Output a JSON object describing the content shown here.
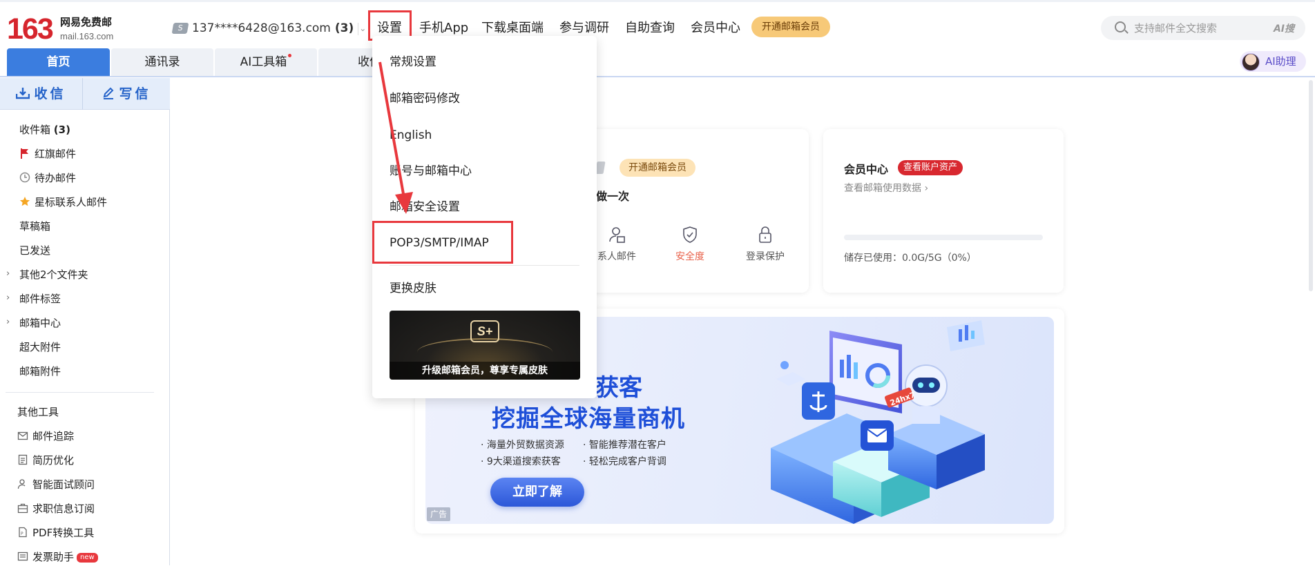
{
  "logo": {
    "number": "163",
    "name": "网易免费邮",
    "url": "mail.163.com"
  },
  "account": {
    "badge": "S",
    "address": "137****6428@163.com",
    "count": "(3)"
  },
  "topnav": {
    "settings": "设置",
    "mobile_app": "手机App",
    "desktop": "下载桌面端",
    "survey": "参与调研",
    "self_query": "自助查询",
    "member_center": "会员中心",
    "vip_button": "开通邮箱会员"
  },
  "search": {
    "placeholder": "支持邮件全文搜索",
    "ai_label": "AI搜"
  },
  "tabs": [
    {
      "label": "首页",
      "active": true
    },
    {
      "label": "通讯录"
    },
    {
      "label": "AI工具箱",
      "dot": true
    },
    {
      "label": "收件"
    }
  ],
  "ai_assistant": "AI助理",
  "sidebar": {
    "receive": "收信",
    "write": "写信",
    "items": [
      {
        "label": "收件箱",
        "count": "(3)"
      },
      {
        "label": "红旗邮件",
        "icon": "flag-icon"
      },
      {
        "label": "待办邮件",
        "icon": "clock-icon"
      },
      {
        "label": "星标联系人邮件",
        "icon": "star-icon"
      },
      {
        "label": "草稿箱"
      },
      {
        "label": "已发送"
      },
      {
        "label": "其他2个文件夹"
      },
      {
        "label": "邮件标签"
      },
      {
        "label": "邮箱中心"
      },
      {
        "label": "超大附件"
      },
      {
        "label": "邮箱附件"
      }
    ],
    "tools_title": "其他工具",
    "tools": [
      {
        "label": "邮件追踪",
        "icon": "mail-track-icon"
      },
      {
        "label": "简历优化",
        "icon": "resume-icon"
      },
      {
        "label": "智能面试顾问",
        "icon": "interview-icon"
      },
      {
        "label": "求职信息订阅",
        "icon": "job-icon"
      },
      {
        "label": "PDF转换工具",
        "icon": "pdf-icon"
      },
      {
        "label": "发票助手",
        "icon": "invoice-icon",
        "badge": "new"
      }
    ]
  },
  "dropdown": {
    "items": [
      "常规设置",
      "邮箱密码修改",
      "English",
      "账号与邮箱中心",
      "邮箱安全设置",
      "POP3/SMTP/IMAP",
      "更换皮肤"
    ],
    "promo_caption": "升级邮箱会员，尊享专属皮肤",
    "promo_logo": "S+"
  },
  "card_left": {
    "vip_pill": "开通邮箱会员",
    "partial_text": "做一次",
    "quick": [
      {
        "label": "系人邮件",
        "icon": "contact-mail-icon"
      },
      {
        "label": "安全度",
        "icon": "shield-icon",
        "color": "#e8614a"
      },
      {
        "label": "登录保护",
        "icon": "lock-icon"
      }
    ]
  },
  "card_right": {
    "title": "会员中心",
    "badge": "查看账户资产",
    "link": "查看邮箱使用数据 ›",
    "storage": "储存已使用：0.0G/5G（0%）"
  },
  "banner": {
    "title1": "获客",
    "title2": "挖掘全球海量商机",
    "bullets": [
      "· 海量外贸数据资源",
      "· 智能推荐潜在客户",
      "· 9大渠道搜索获客",
      "· 轻松完成客户背调"
    ],
    "cta": "立即了解",
    "ad": "广告",
    "bot_tag": "24hx7"
  },
  "colors": {
    "brand_red": "#d6252d",
    "primary_blue": "#3b7ddf",
    "highlight_red": "#e8383d"
  }
}
